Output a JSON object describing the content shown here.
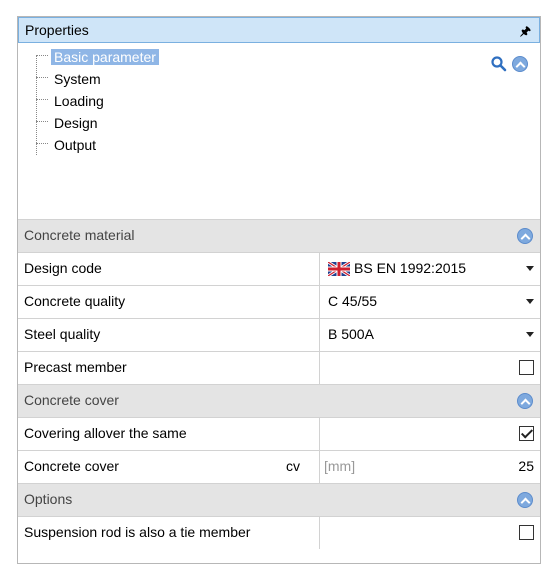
{
  "panel": {
    "title": "Properties",
    "pin_icon": "pin-icon"
  },
  "tree": {
    "items": [
      {
        "label": "Basic parameter",
        "selected": true
      },
      {
        "label": "System"
      },
      {
        "label": "Loading"
      },
      {
        "label": "Design"
      },
      {
        "label": "Output"
      }
    ]
  },
  "sections": {
    "concrete_material": {
      "title": "Concrete material",
      "design_code": {
        "label": "Design code",
        "value": "BS EN 1992:2015"
      },
      "concrete_quality": {
        "label": "Concrete quality",
        "value": "C 45/55"
      },
      "steel_quality": {
        "label": "Steel quality",
        "value": "B 500A"
      },
      "precast_member": {
        "label": "Precast member",
        "checked": false
      }
    },
    "concrete_cover": {
      "title": "Concrete cover",
      "covering_same": {
        "label": "Covering allover the same",
        "checked": true
      },
      "cover": {
        "label": "Concrete cover",
        "symbol": "cv",
        "unit": "[mm]",
        "value": "25"
      }
    },
    "options": {
      "title": "Options",
      "suspension_rod": {
        "label": "Suspension rod is also a tie member",
        "checked": false
      }
    }
  },
  "colors": {
    "title_bar": "#cfe5f8",
    "selected_item": "#8fb6e6",
    "section_header": "#e4e4e4",
    "collapse_button": "#7ea9de"
  }
}
